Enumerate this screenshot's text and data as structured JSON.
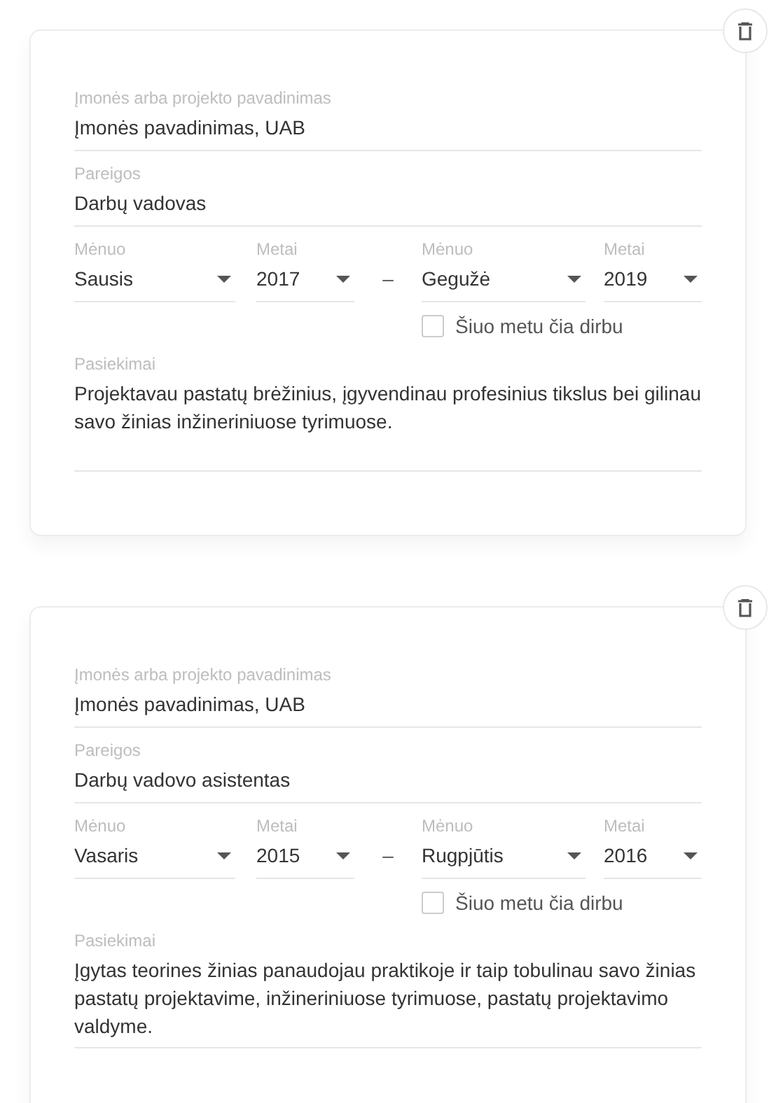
{
  "entries": [
    {
      "company": {
        "label": "Įmonės arba projekto pavadinimas",
        "value": "Įmonės pavadinimas, UAB"
      },
      "position": {
        "label": "Pareigos",
        "value": "Darbų vadovas"
      },
      "start_month": {
        "label": "Mėnuo",
        "value": "Sausis"
      },
      "start_year": {
        "label": "Metai",
        "value": "2017"
      },
      "separator": "–",
      "end_month": {
        "label": "Mėnuo",
        "value": "Gegužė"
      },
      "end_year": {
        "label": "Metai",
        "value": "2019"
      },
      "currently_working": {
        "label": "Šiuo metu čia dirbu",
        "checked": false
      },
      "achievements": {
        "label": "Pasiekimai",
        "value": "Projektavau pastatų brėžinius, įgyvendinau profesinius tikslus bei gilinau savo žinias inžineriniuose tyrimuose."
      }
    },
    {
      "company": {
        "label": "Įmonės arba projekto pavadinimas",
        "value": "Įmonės pavadinimas, UAB"
      },
      "position": {
        "label": "Pareigos",
        "value": "Darbų vadovo asistentas"
      },
      "start_month": {
        "label": "Mėnuo",
        "value": "Vasaris"
      },
      "start_year": {
        "label": "Metai",
        "value": "2015"
      },
      "separator": "–",
      "end_month": {
        "label": "Mėnuo",
        "value": "Rugpjūtis"
      },
      "end_year": {
        "label": "Metai",
        "value": "2016"
      },
      "currently_working": {
        "label": "Šiuo metu čia dirbu",
        "checked": false
      },
      "achievements": {
        "label": "Pasiekimai",
        "value": "Įgytas teorines žinias panaudojau praktikoje ir taip tobulinau savo žinias pastatų projektavime, inžineriniuose tyrimuose, pastatų projektavimo valdyme."
      }
    }
  ]
}
